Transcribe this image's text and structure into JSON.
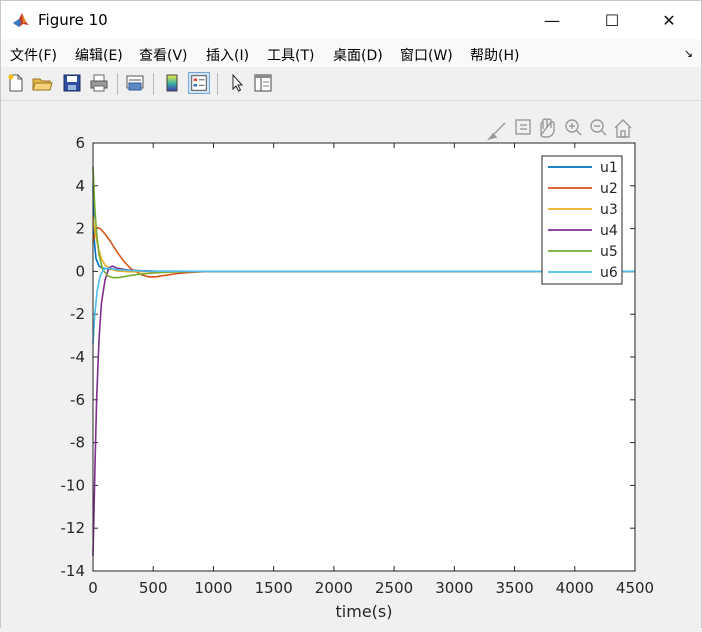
{
  "window": {
    "title": "Figure 10",
    "minimize_glyph": "—",
    "maximize_glyph": "☐",
    "close_glyph": "✕"
  },
  "menu": {
    "items": [
      "文件(F)",
      "编辑(E)",
      "查看(V)",
      "插入(I)",
      "工具(T)",
      "桌面(D)",
      "窗口(W)",
      "帮助(H)"
    ],
    "overflow_glyph": "↘"
  },
  "toolbar": {
    "buttons": [
      "new-figure-icon",
      "open-file-icon",
      "save-icon",
      "print-icon",
      "link-plot-icon",
      "colorbar-icon",
      "legend-icon",
      "edit-plot-icon",
      "property-inspector-icon"
    ]
  },
  "axes_toolbar": {
    "buttons": [
      "brush-icon",
      "data-tips-icon",
      "pan-icon",
      "zoom-in-icon",
      "zoom-out-icon",
      "home-icon"
    ]
  },
  "colors": {
    "u1": "#0072BD",
    "u2": "#D95319",
    "u3": "#EDB120",
    "u4": "#7E2F8E",
    "u5": "#77AC30",
    "u6": "#4DBEEE"
  },
  "chart_data": {
    "type": "line",
    "title": "",
    "xlabel": "time(s)",
    "ylabel": "",
    "xlim": [
      0,
      4500
    ],
    "ylim": [
      -14,
      6
    ],
    "xticks": [
      0,
      500,
      1000,
      1500,
      2000,
      2500,
      3000,
      3500,
      4000,
      4500
    ],
    "yticks": [
      -14,
      -12,
      -10,
      -8,
      -6,
      -4,
      -2,
      0,
      2,
      4,
      6
    ],
    "grid": false,
    "legend": "top-right",
    "series": [
      {
        "name": "u1",
        "x": [
          0,
          10,
          25,
          50,
          80,
          120,
          160,
          200,
          300,
          500,
          1000,
          4500
        ],
        "y": [
          4.0,
          1.5,
          0.6,
          0.25,
          0.15,
          0.12,
          0.1,
          0.08,
          0.05,
          0.02,
          0.0,
          0.0
        ]
      },
      {
        "name": "u2",
        "x": [
          0,
          30,
          60,
          100,
          150,
          200,
          260,
          320,
          400,
          460,
          520,
          600,
          700,
          800,
          900,
          1000,
          1200,
          4500
        ],
        "y": [
          1.4,
          2.05,
          2.0,
          1.75,
          1.35,
          0.9,
          0.45,
          0.1,
          -0.15,
          -0.25,
          -0.25,
          -0.18,
          -0.1,
          -0.05,
          -0.02,
          0.0,
          0.0,
          0.0
        ]
      },
      {
        "name": "u3",
        "x": [
          0,
          15,
          40,
          70,
          100,
          150,
          200,
          300,
          500,
          700,
          1000,
          4500
        ],
        "y": [
          2.6,
          1.9,
          1.2,
          0.6,
          0.3,
          0.1,
          0.02,
          -0.02,
          0.0,
          0.0,
          0.0,
          0.0
        ]
      },
      {
        "name": "u4",
        "x": [
          0,
          15,
          30,
          50,
          70,
          100,
          130,
          160,
          200,
          300,
          500,
          4500
        ],
        "y": [
          -13.3,
          -9.5,
          -6.0,
          -3.2,
          -1.5,
          -0.4,
          0.15,
          0.25,
          0.15,
          0.05,
          0.0,
          0.0
        ]
      },
      {
        "name": "u5",
        "x": [
          0,
          15,
          30,
          50,
          80,
          120,
          170,
          220,
          300,
          400,
          500,
          600,
          800,
          1000,
          4500
        ],
        "y": [
          4.9,
          3.0,
          1.8,
          0.8,
          0.1,
          -0.2,
          -0.3,
          -0.28,
          -0.2,
          -0.12,
          -0.07,
          -0.04,
          -0.01,
          0.0,
          0.0
        ]
      },
      {
        "name": "u6",
        "x": [
          0,
          15,
          35,
          60,
          90,
          120,
          160,
          200,
          300,
          500,
          1000,
          4500
        ],
        "y": [
          -3.4,
          -2.0,
          -0.9,
          -0.2,
          0.1,
          0.15,
          0.12,
          0.08,
          0.04,
          0.01,
          0.0,
          0.0
        ]
      }
    ]
  }
}
